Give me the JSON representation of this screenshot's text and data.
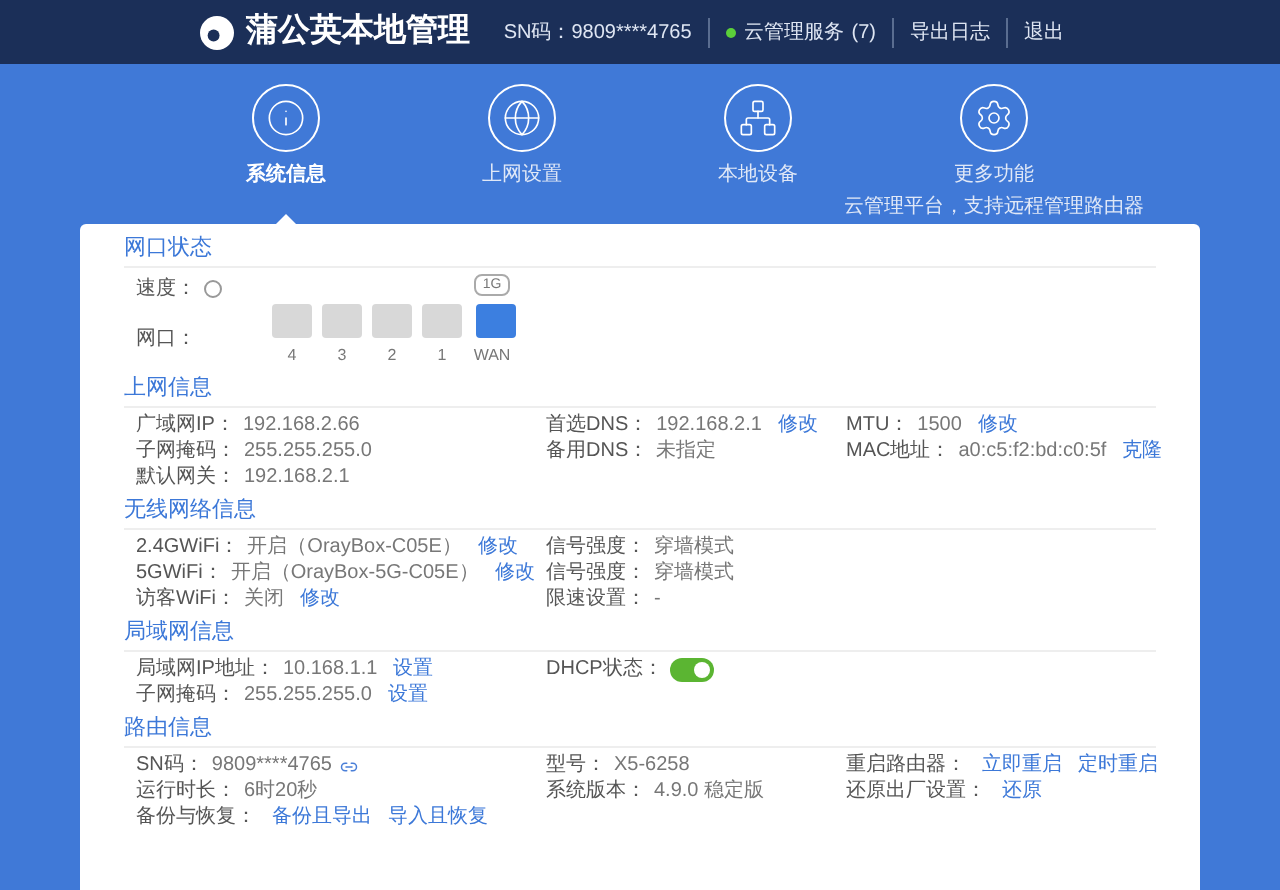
{
  "header": {
    "title": "蒲公英本地管理",
    "sn": "SN码：9809****4765",
    "cloud_service": {
      "label": "云管理服务",
      "count": "(7)",
      "online": true
    },
    "links": [
      "导出日志",
      "退出"
    ]
  },
  "nav": [
    {
      "label": "系统信息",
      "selected": true
    },
    {
      "label": "上网设置",
      "selected": false
    },
    {
      "label": "本地设备",
      "selected": false
    },
    {
      "label": "更多功能",
      "selected": false,
      "subtitle": "云管理平台，支持远程管理路由器"
    }
  ],
  "sections": [
    {
      "kind": "ports",
      "title": "网口状态",
      "speed_label": "速度：",
      "speed_badge": "1G",
      "ports_label": "网口：",
      "ports": [
        {
          "label": "4",
          "active": false
        },
        {
          "label": "3",
          "active": false
        },
        {
          "label": "2",
          "active": false
        },
        {
          "label": "1",
          "active": false
        },
        {
          "label": "WAN",
          "active": true
        }
      ]
    },
    {
      "kind": "grid",
      "title": "上网信息",
      "rows": [
        [
          {
            "label": "广域网IP：",
            "value": "192.168.2.66"
          },
          {
            "label": "首选DNS：",
            "value": "192.168.2.1",
            "links": [
              "修改"
            ]
          },
          {
            "label": "MTU：",
            "value": "1500",
            "links": [
              "修改"
            ]
          }
        ],
        [
          {
            "label": "子网掩码：",
            "value": "255.255.255.0"
          },
          {
            "label": "备用DNS：",
            "value": "未指定"
          },
          {
            "label": "MAC地址：",
            "value": "a0:c5:f2:bd:c0:5f",
            "links": [
              "克隆"
            ]
          }
        ],
        [
          {
            "label": "默认网关：",
            "value": "192.168.2.1"
          }
        ]
      ]
    },
    {
      "kind": "grid",
      "title": "无线网络信息",
      "rows": [
        [
          {
            "label": "2.4GWiFi：",
            "value": "开启（OrayBox-C05E）",
            "links": [
              "修改"
            ]
          },
          {
            "label": "信号强度：",
            "value": "穿墙模式"
          }
        ],
        [
          {
            "label": "5GWiFi：",
            "value": "开启（OrayBox-5G-C05E）",
            "links": [
              "修改"
            ]
          },
          {
            "label": "信号强度：",
            "value": "穿墙模式"
          }
        ],
        [
          {
            "label": "访客WiFi：",
            "value": "关闭",
            "links": [
              "修改"
            ]
          },
          {
            "label": "限速设置：",
            "value": "-"
          }
        ]
      ]
    },
    {
      "kind": "grid",
      "title": "局域网信息",
      "rows": [
        [
          {
            "label": "局域网IP地址：",
            "value": "10.168.1.1",
            "links": [
              "设置"
            ]
          },
          {
            "kind": "toggle",
            "label": "DHCP状态：",
            "on": true
          }
        ],
        [
          {
            "label": "子网掩码：",
            "value": "255.255.255.0",
            "links": [
              "设置"
            ]
          }
        ]
      ]
    },
    {
      "kind": "grid",
      "title": "路由信息",
      "rows": [
        [
          {
            "label": "SN码：",
            "value": "9809****4765",
            "icon": true
          },
          {
            "label": "型号：",
            "value": "X5-6258"
          },
          {
            "label": "重启路由器：",
            "links": [
              "立即重启",
              "定时重启"
            ]
          }
        ],
        [
          {
            "label": "运行时长：",
            "value": "6时20秒"
          },
          {
            "label": "系统版本：",
            "value": "4.9.0 稳定版"
          },
          {
            "label": "还原出厂设置：",
            "links": [
              "还原"
            ]
          }
        ],
        [
          {
            "label": "备份与恢复：",
            "links": [
              "备份且导出",
              "导入且恢复"
            ]
          }
        ]
      ]
    }
  ]
}
